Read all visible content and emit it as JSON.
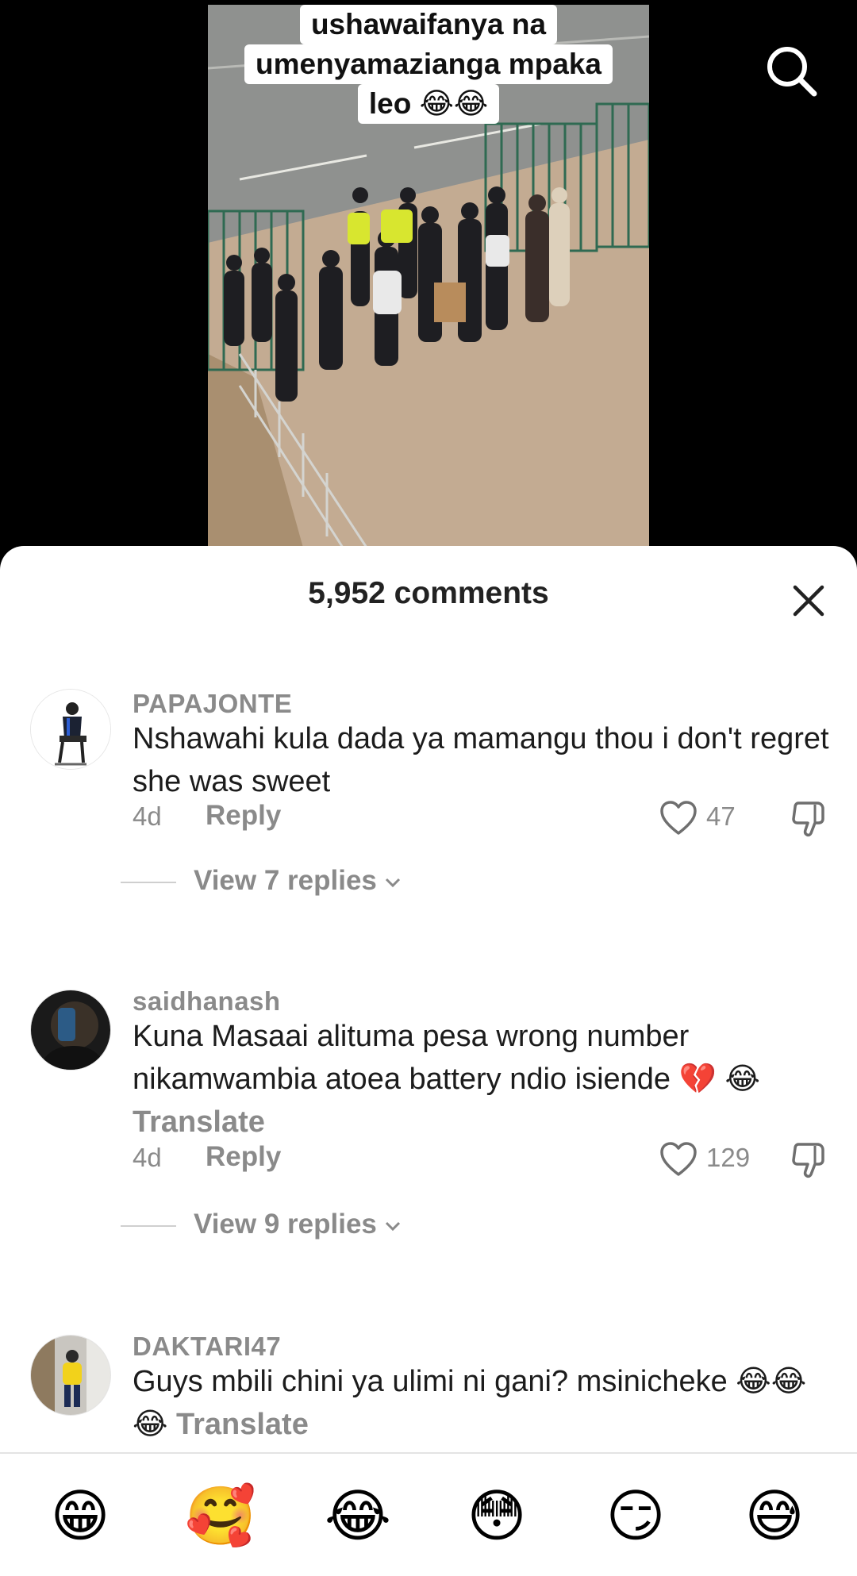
{
  "video": {
    "caption_lines": [
      "ushawaifanya na",
      "umenyamazianga mpaka",
      "leo 😂😂"
    ]
  },
  "icons": {
    "search": "search-icon",
    "close": "close-icon",
    "like": "heart-outline-icon",
    "dislike": "thumbs-down-icon",
    "chevron": "chevron-down-icon"
  },
  "sheet": {
    "title": "5,952 comments"
  },
  "comments": [
    {
      "username": "PAPAJONTE",
      "text": "Nshawahi kula dada ya mamangu thou i don't regret she was sweet",
      "translate": "",
      "time": "4d",
      "reply_label": "Reply",
      "likes": "47",
      "view_replies": "View 7 replies"
    },
    {
      "username": "saidhanash",
      "text": "Kuna Masaai alituma pesa wrong number nikamwambia atoea battery ndio isiende 💔 😂",
      "translate": "Translate",
      "time": "4d",
      "reply_label": "Reply",
      "likes": "129",
      "view_replies": "View 9 replies"
    },
    {
      "username": "DAKTARI47",
      "text": "Guys mbili chini ya ulimi ni gani? msinicheke 😂😂😂",
      "translate": "Translate"
    }
  ],
  "emoji_bar": [
    "😁",
    "🥰",
    "😂",
    "😳",
    "😏",
    "😅"
  ],
  "colors": {
    "sheet_bg": "#ffffff",
    "muted_text": "#8a8a8a",
    "body_text": "#1c1c1c"
  }
}
